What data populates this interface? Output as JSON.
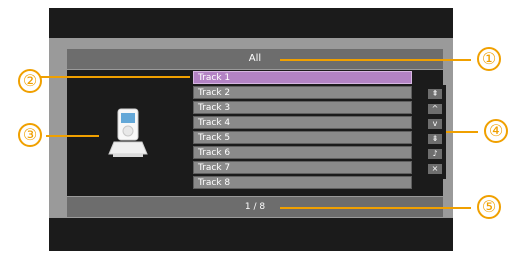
{
  "title": "All",
  "tracks": [
    {
      "label": "Track 1",
      "selected": true
    },
    {
      "label": "Track 2",
      "selected": false
    },
    {
      "label": "Track 3",
      "selected": false
    },
    {
      "label": "Track 4",
      "selected": false
    },
    {
      "label": "Track 5",
      "selected": false
    },
    {
      "label": "Track 6",
      "selected": false
    },
    {
      "label": "Track 7",
      "selected": false
    },
    {
      "label": "Track 8",
      "selected": false
    }
  ],
  "controls": [
    {
      "symbol": "⇞"
    },
    {
      "symbol": "^"
    },
    {
      "symbol": "v"
    },
    {
      "symbol": "⇟"
    },
    {
      "symbol": "♪"
    },
    {
      "symbol": "×"
    }
  ],
  "footer": "1 / 8",
  "callouts": [
    "①",
    "②",
    "③",
    "④",
    "⑤"
  ],
  "colors": {
    "accent": "#f0a000",
    "selected": "#b383c4"
  },
  "icons": {
    "device": "ipod-dock-icon"
  }
}
